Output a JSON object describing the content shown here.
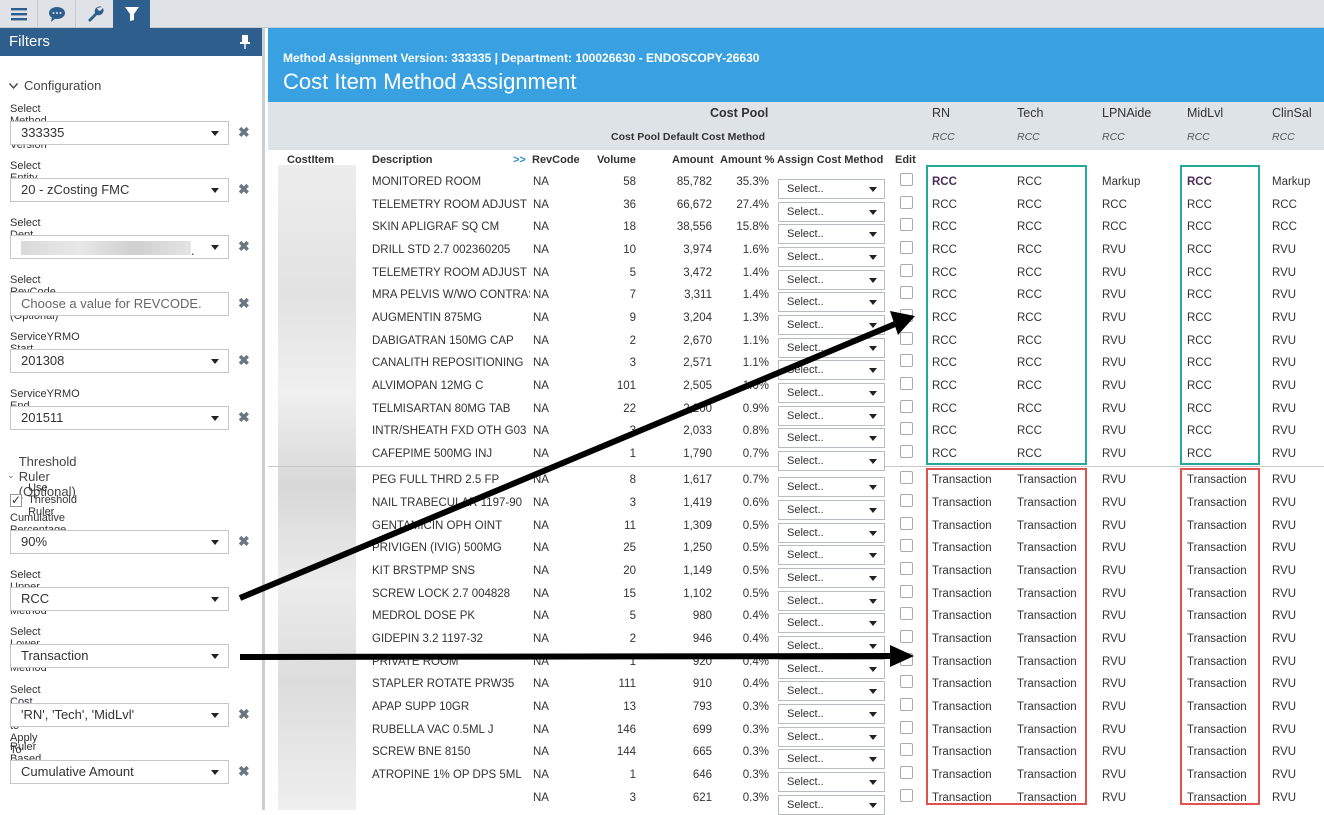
{
  "toolbar": {
    "icons": [
      "menu-icon",
      "chat-icon",
      "wrench-icon",
      "filter-icon"
    ]
  },
  "panel": {
    "title": "Filters",
    "configuration_title": "Configuration",
    "threshold_title": "Threshold Ruler (Optional)",
    "use_threshold_label": "Use Threshold Ruler",
    "use_threshold_checked": true,
    "fields": {
      "method_version": {
        "label": "Select Method Assignment Version",
        "value": "333335"
      },
      "entity": {
        "label": "Select Entity",
        "value": "20 - zCosting FMC"
      },
      "dept": {
        "label": "Select Dept",
        "value": "."
      },
      "revcode": {
        "label": "Select RevCode Filter (Optional)",
        "placeholder": "Choose a value for REVCODE."
      },
      "yrmo_start": {
        "label": "ServiceYRMO Start",
        "value": "201308"
      },
      "yrmo_end": {
        "label": "ServiceYRMO End",
        "value": "201511"
      },
      "cum_pct": {
        "label": "Cumulative Percentage of Total",
        "value": "90%"
      },
      "upper": {
        "label": "Select Upper Default Method",
        "value": "RCC"
      },
      "lower": {
        "label": "Select Lower Default Method",
        "value": "Transaction"
      },
      "pools": {
        "label": "Select Cost Pools to Apply To",
        "value": "'RN', 'Tech', 'MidLvl'"
      },
      "ruler": {
        "label": "Ruler Based On",
        "value": "Cumulative Amount"
      }
    }
  },
  "header": {
    "subtitle": "Method Assignment Version: 333335 | Department: 100026630 - ENDOSCOPY-26630",
    "title": "Cost Item Method Assignment"
  },
  "cost_pool": {
    "label": "Cost Pool",
    "default_label": "Cost Pool Default Cost Method",
    "pools": [
      "RN",
      "Tech",
      "LPNAide",
      "MidLvl",
      "ClinSal"
    ],
    "defaults": [
      "RCC",
      "RCC",
      "RCC",
      "RCC",
      "RCC"
    ]
  },
  "columns": {
    "costitem": "CostItem",
    "description": "Description",
    "expand": ">>",
    "revcode": "RevCode",
    "volume": "Volume",
    "amount": "Amount",
    "amount_pct": "Amount %",
    "assign": "Assign Cost Method",
    "edit": "Edit"
  },
  "select_placeholder": "Select..",
  "rows": [
    {
      "desc": "MONITORED ROOM",
      "rev": "NA",
      "vol": "58",
      "amt": "85,782",
      "pct": "35.3%",
      "m": [
        "RCC",
        "RCC",
        "Markup",
        "RCC",
        "Markup"
      ]
    },
    {
      "desc": "TELEMETRY ROOM ADJUST",
      "rev": "NA",
      "vol": "36",
      "amt": "66,672",
      "pct": "27.4%",
      "m": [
        "RCC",
        "RCC",
        "RCC",
        "RCC",
        "RCC"
      ]
    },
    {
      "desc": "SKIN APLIGRAF SQ CM",
      "rev": "NA",
      "vol": "18",
      "amt": "38,556",
      "pct": "15.8%",
      "m": [
        "RCC",
        "RCC",
        "RCC",
        "RCC",
        "RCC"
      ]
    },
    {
      "desc": "DRILL STD 2.7 002360205",
      "rev": "NA",
      "vol": "10",
      "amt": "3,974",
      "pct": "1.6%",
      "m": [
        "RCC",
        "RCC",
        "RVU",
        "RCC",
        "RVU"
      ]
    },
    {
      "desc": "TELEMETRY ROOM ADJUST",
      "rev": "NA",
      "vol": "5",
      "amt": "3,472",
      "pct": "1.4%",
      "m": [
        "RCC",
        "RCC",
        "RVU",
        "RCC",
        "RVU"
      ]
    },
    {
      "desc": "MRA PELVIS W/WO CONTRAST",
      "rev": "NA",
      "vol": "7",
      "amt": "3,311",
      "pct": "1.4%",
      "m": [
        "RCC",
        "RCC",
        "RVU",
        "RCC",
        "RVU"
      ]
    },
    {
      "desc": "AUGMENTIN 875MG",
      "rev": "NA",
      "vol": "9",
      "amt": "3,204",
      "pct": "1.3%",
      "m": [
        "RCC",
        "RCC",
        "RVU",
        "RCC",
        "RVU"
      ]
    },
    {
      "desc": "DABIGATRAN 150MG CAP",
      "rev": "NA",
      "vol": "2",
      "amt": "2,670",
      "pct": "1.1%",
      "m": [
        "RCC",
        "RCC",
        "RVU",
        "RCC",
        "RVU"
      ]
    },
    {
      "desc": "CANALITH REPOSITIONING",
      "rev": "NA",
      "vol": "3",
      "amt": "2,571",
      "pct": "1.1%",
      "m": [
        "RCC",
        "RCC",
        "RVU",
        "RCC",
        "RVU"
      ]
    },
    {
      "desc": "ALVIMOPAN 12MG C",
      "rev": "NA",
      "vol": "101",
      "amt": "2,505",
      "pct": "1.0%",
      "m": [
        "RCC",
        "RCC",
        "RVU",
        "RCC",
        "RVU"
      ]
    },
    {
      "desc": "TELMISARTAN 80MG TAB",
      "rev": "NA",
      "vol": "22",
      "amt": "2,200",
      "pct": "0.9%",
      "m": [
        "RCC",
        "RCC",
        "RVU",
        "RCC",
        "RVU"
      ]
    },
    {
      "desc": "INTR/SHEATH FXD OTH G03",
      "rev": "NA",
      "vol": "3",
      "amt": "2,033",
      "pct": "0.8%",
      "m": [
        "RCC",
        "RCC",
        "RVU",
        "RCC",
        "RVU"
      ]
    },
    {
      "desc": "CAFEPIME 500MG INJ",
      "rev": "NA",
      "vol": "1",
      "amt": "1,790",
      "pct": "0.7%",
      "m": [
        "RCC",
        "RCC",
        "RVU",
        "RCC",
        "RVU"
      ]
    },
    {
      "desc": "PEG FULL THRD 2.5 FP",
      "rev": "NA",
      "vol": "8",
      "amt": "1,617",
      "pct": "0.7%",
      "m": [
        "Transaction",
        "Transaction",
        "RVU",
        "Transaction",
        "RVU"
      ]
    },
    {
      "desc": "NAIL TRABECULAR 1197-90",
      "rev": "NA",
      "vol": "3",
      "amt": "1,419",
      "pct": "0.6%",
      "m": [
        "Transaction",
        "Transaction",
        "RVU",
        "Transaction",
        "RVU"
      ]
    },
    {
      "desc": "GENTAMICIN OPH OINT",
      "rev": "NA",
      "vol": "11",
      "amt": "1,309",
      "pct": "0.5%",
      "m": [
        "Transaction",
        "Transaction",
        "RVU",
        "Transaction",
        "RVU"
      ]
    },
    {
      "desc": "PRIVIGEN (IVIG) 500MG",
      "rev": "NA",
      "vol": "25",
      "amt": "1,250",
      "pct": "0.5%",
      "m": [
        "Transaction",
        "Transaction",
        "RVU",
        "Transaction",
        "RVU"
      ]
    },
    {
      "desc": "KIT BRSTPMP SNS",
      "rev": "NA",
      "vol": "20",
      "amt": "1,149",
      "pct": "0.5%",
      "m": [
        "Transaction",
        "Transaction",
        "RVU",
        "Transaction",
        "RVU"
      ]
    },
    {
      "desc": "SCREW LOCK 2.7 004828",
      "rev": "NA",
      "vol": "15",
      "amt": "1,102",
      "pct": "0.5%",
      "m": [
        "Transaction",
        "Transaction",
        "RVU",
        "Transaction",
        "RVU"
      ]
    },
    {
      "desc": "MEDROL DOSE PK",
      "rev": "NA",
      "vol": "5",
      "amt": "980",
      "pct": "0.4%",
      "m": [
        "Transaction",
        "Transaction",
        "RVU",
        "Transaction",
        "RVU"
      ]
    },
    {
      "desc": "GIDEPIN 3.2 1197-32",
      "rev": "NA",
      "vol": "2",
      "amt": "946",
      "pct": "0.4%",
      "m": [
        "Transaction",
        "Transaction",
        "RVU",
        "Transaction",
        "RVU"
      ]
    },
    {
      "desc": "PRIVATE ROOM",
      "rev": "NA",
      "vol": "1",
      "amt": "920",
      "pct": "0.4%",
      "m": [
        "Transaction",
        "Transaction",
        "RVU",
        "Transaction",
        "RVU"
      ]
    },
    {
      "desc": "STAPLER ROTATE PRW35",
      "rev": "NA",
      "vol": "111",
      "amt": "910",
      "pct": "0.4%",
      "m": [
        "Transaction",
        "Transaction",
        "RVU",
        "Transaction",
        "RVU"
      ]
    },
    {
      "desc": "APAP SUPP 10GR",
      "rev": "NA",
      "vol": "13",
      "amt": "793",
      "pct": "0.3%",
      "m": [
        "Transaction",
        "Transaction",
        "RVU",
        "Transaction",
        "RVU"
      ]
    },
    {
      "desc": "RUBELLA VAC 0.5ML J",
      "rev": "NA",
      "vol": "146",
      "amt": "699",
      "pct": "0.3%",
      "m": [
        "Transaction",
        "Transaction",
        "RVU",
        "Transaction",
        "RVU"
      ]
    },
    {
      "desc": "SCREW BNE 8150",
      "rev": "NA",
      "vol": "144",
      "amt": "665",
      "pct": "0.3%",
      "m": [
        "Transaction",
        "Transaction",
        "RVU",
        "Transaction",
        "RVU"
      ]
    },
    {
      "desc": "ATROPINE 1% OP DPS 5ML",
      "rev": "NA",
      "vol": "1",
      "amt": "646",
      "pct": "0.3%",
      "m": [
        "Transaction",
        "Transaction",
        "RVU",
        "Transaction",
        "RVU"
      ]
    },
    {
      "desc": "",
      "rev": "NA",
      "vol": "3",
      "amt": "621",
      "pct": "0.3%",
      "m": [
        "Transaction",
        "Transaction",
        "RVU",
        "Transaction",
        "RVU"
      ]
    }
  ],
  "colors": {
    "panel_header": "#2e5f8c",
    "banner": "#39a0e1",
    "teal_box": "#24a89a",
    "red_box": "#e0524f",
    "arrow": "#000000"
  }
}
